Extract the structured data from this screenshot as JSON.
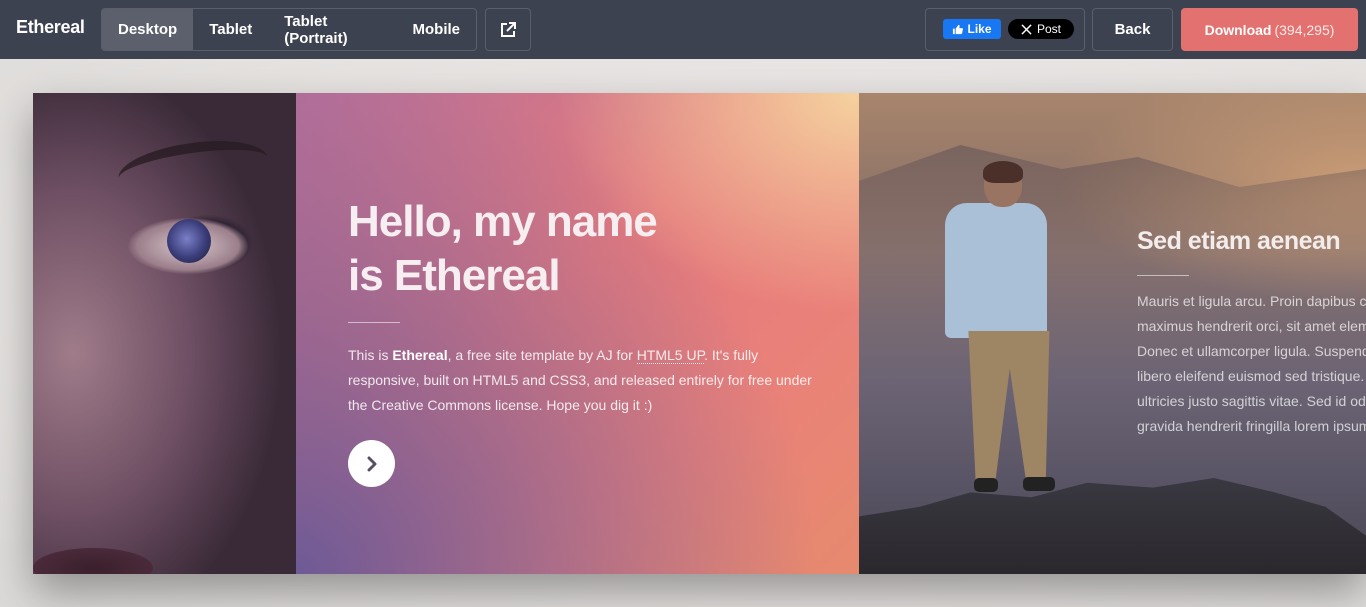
{
  "topbar": {
    "brand": "Ethereal",
    "devices": [
      "Desktop",
      "Tablet",
      "Tablet (Portrait)",
      "Mobile"
    ],
    "active_device": "Desktop",
    "fb_like": "Like",
    "x_post": "Post",
    "back": "Back",
    "download": "Download",
    "download_count": "(394,295)"
  },
  "intro": {
    "title_line1": "Hello, my name",
    "title_line2": "is Ethereal",
    "text_1": "This is ",
    "text_bold": "Ethereal",
    "text_2": ", a free site template by AJ for ",
    "text_link": "HTML5 UP",
    "text_3": ". It's fully responsive, built on HTML5 and CSS3, and released entirely for free under the Creative Commons license. Hope you dig it :)"
  },
  "section2": {
    "title": "Sed etiam aenean",
    "lines": [
      "Mauris et ligula arcu. Proin dapibus co",
      "maximus hendrerit orci, sit amet elem",
      "Donec et ullamcorper ligula. Suspendi",
      "libero eleifend euismod sed tristique. (",
      "ultricies justo sagittis vitae. Sed id odio",
      "gravida hendrerit fringilla lorem ipsum"
    ]
  },
  "colors": {
    "topbar": "#3d4250",
    "download": "#e2716f",
    "facebook": "#1877f2"
  },
  "icons": [
    "external-link-icon",
    "facebook-thumb-icon",
    "x-logo-icon",
    "chevron-right-icon"
  ]
}
